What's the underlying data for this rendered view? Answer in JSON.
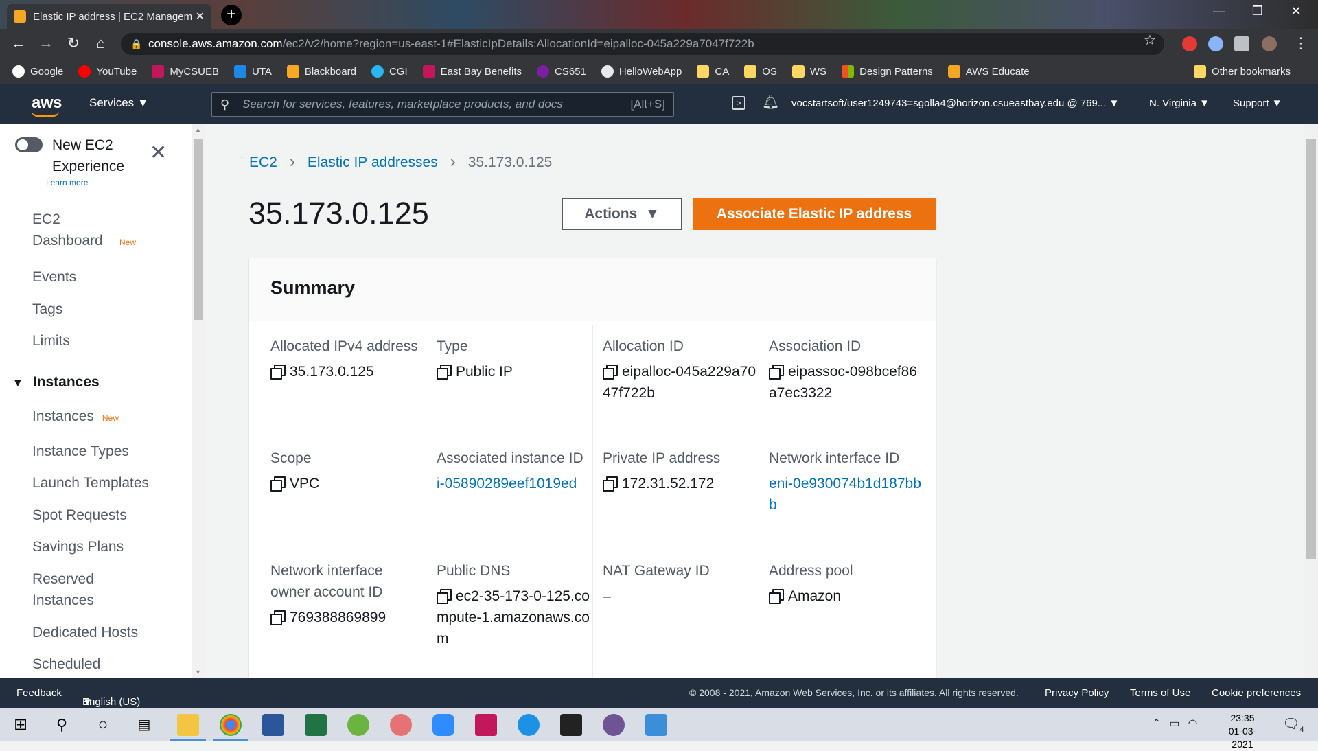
{
  "browser": {
    "tab_title": "Elastic IP address | EC2 Managem",
    "url_host": "console.aws.amazon.com",
    "url_path": "/ec2/v2/home?region=us-east-1#ElasticIpDetails:AllocationId=eipalloc-045a229a7047f722b",
    "bookmarks": [
      "Google",
      "YouTube",
      "MyCSUEB",
      "UTA",
      "Blackboard",
      "CGI",
      "East Bay Benefits",
      "CS651",
      "HelloWebApp",
      "CA",
      "OS",
      "WS",
      "Design Patterns",
      "AWS Educate"
    ],
    "other_bookmarks": "Other bookmarks"
  },
  "aws_nav": {
    "logo": "aws",
    "services": "Services",
    "search_placeholder": "Search for services, features, marketplace products, and docs",
    "search_shortcut": "[Alt+S]",
    "account": "vocstartsoft/user1249743=sgolla4@horizon.csueastbay.edu @ 769...",
    "region": "N. Virginia",
    "support": "Support"
  },
  "sidebar": {
    "new_experience": "New EC2 Experience",
    "learn_more": "Learn more",
    "new_badge": "New",
    "items": [
      "EC2 Dashboard",
      "Events",
      "Tags",
      "Limits"
    ],
    "section": "Instances",
    "instance_items": [
      "Instances",
      "Instance Types",
      "Launch Templates",
      "Spot Requests",
      "Savings Plans",
      "Reserved Instances",
      "Dedicated Hosts",
      "Scheduled"
    ]
  },
  "main": {
    "breadcrumb": [
      "EC2",
      "Elastic IP addresses",
      "35.173.0.125"
    ],
    "title": "35.173.0.125",
    "actions_label": "Actions",
    "associate_label": "Associate Elastic IP address",
    "summary_title": "Summary",
    "fields": {
      "allocated_ipv4": {
        "label": "Allocated IPv4 address",
        "value": "35.173.0.125"
      },
      "type": {
        "label": "Type",
        "value": "Public IP"
      },
      "allocation_id": {
        "label": "Allocation ID",
        "value": "eipalloc-045a229a7047f722b"
      },
      "association_id": {
        "label": "Association ID",
        "value": "eipassoc-098bcef86a7ec3322"
      },
      "scope": {
        "label": "Scope",
        "value": "VPC"
      },
      "associated_instance": {
        "label": "Associated instance ID",
        "value": "i-05890289eef1019ed"
      },
      "private_ip": {
        "label": "Private IP address",
        "value": "172.31.52.172"
      },
      "network_interface": {
        "label": "Network interface ID",
        "value": "eni-0e930074b1d187bbb"
      },
      "ni_owner": {
        "label": "Network interface owner account ID",
        "value": "769388869899"
      },
      "public_dns": {
        "label": "Public DNS",
        "value": "ec2-35-173-0-125.compute-1.amazonaws.com"
      },
      "nat_gateway": {
        "label": "NAT Gateway ID",
        "value": "–"
      },
      "address_pool": {
        "label": "Address pool",
        "value": "Amazon"
      }
    }
  },
  "footer": {
    "feedback": "Feedback",
    "language": "English (US)",
    "copyright": "© 2008 - 2021, Amazon Web Services, Inc. or its affiliates. All rights reserved.",
    "privacy": "Privacy Policy",
    "terms": "Terms of Use",
    "cookies": "Cookie preferences"
  },
  "taskbar": {
    "time": "23:35",
    "date": "01-03-2021",
    "notifications": "4"
  },
  "colors": {
    "aws_nav": "#232f3e",
    "accent_orange": "#ec7211",
    "link_blue": "#0073bb"
  }
}
